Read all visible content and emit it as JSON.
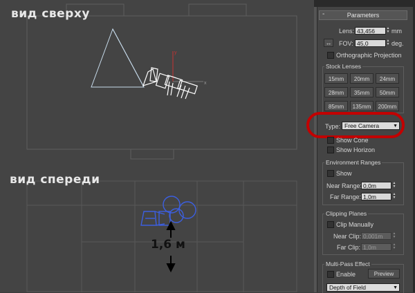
{
  "viewport": {
    "label_top": "вид сверху",
    "label_front": "вид спереди",
    "dimension": "1,6 м",
    "axis_x": "x",
    "axis_y": "y"
  },
  "panel": {
    "title": "Parameters",
    "collapse": "-",
    "lens_label": "Lens:",
    "lens_value": "43,456",
    "lens_unit": "mm",
    "fov_label": "FOV:",
    "fov_value": "45,0",
    "fov_unit": "deg.",
    "fov_dir_icon": "↔",
    "ortho_label": "Orthographic Projection",
    "stock_lenses": {
      "title": "Stock Lenses",
      "buttons": [
        "15mm",
        "20mm",
        "24mm",
        "28mm",
        "35mm",
        "50mm",
        "85mm",
        "135mm",
        "200mm"
      ]
    },
    "type_label": "Type:",
    "type_value": "Free Camera",
    "show_cone": "Show Cone",
    "show_horizon": "Show Horizon",
    "env": {
      "title": "Environment Ranges",
      "show": "Show",
      "near_label": "Near Range:",
      "near_value": "0,0m",
      "far_label": "Far Range:",
      "far_value": "1,0m"
    },
    "clip": {
      "title": "Clipping Planes",
      "manual": "Clip Manually",
      "near_label": "Near Clip:",
      "near_value": "0,001m",
      "far_label": "Far Clip:",
      "far_value": "1,0m"
    },
    "multipass": {
      "title": "Multi-Pass Effect",
      "enable": "Enable",
      "preview": "Preview",
      "effect_value": "Depth of Field"
    },
    "colors": {
      "highlight": "#c20000",
      "input_bg": "#d9d9d9",
      "panel_bg": "#444444"
    }
  }
}
